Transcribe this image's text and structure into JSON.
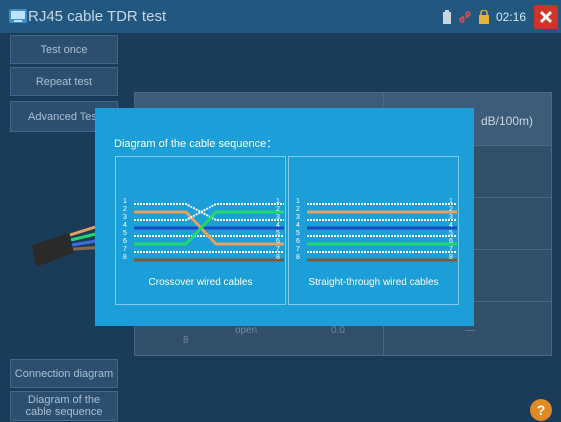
{
  "window": {
    "title": "RJ45 cable TDR test",
    "clock": "02:16"
  },
  "sidebar": {
    "test_once": "Test once",
    "repeat_test": "Repeat test",
    "advanced_test": "Advanced Test",
    "connection_diagram": "Connection diagram",
    "cable_sequence": "Diagram of the cable sequence"
  },
  "results_table": {
    "header_unit": "dB/100m)",
    "row_status": "open",
    "row_value": "0.0",
    "row_pair": "8",
    "row_dash": "—"
  },
  "dialog": {
    "title": "Diagram of the cable sequence：",
    "crossover": {
      "caption": "Crossover wired cables",
      "pins": [
        "1",
        "2",
        "3",
        "4",
        "5",
        "6",
        "7",
        "8"
      ]
    },
    "straight": {
      "caption": "Straight-through wired cables",
      "pins": [
        "1",
        "2",
        "3",
        "4",
        "5",
        "6",
        "7",
        "8"
      ]
    }
  },
  "colors": {
    "dialog_bg": "#1c9ed8",
    "titlebar_bg": "#22587f",
    "close_red": "#d0332c",
    "wire_orange": "#e7a15f",
    "wire_green": "#21d86a",
    "wire_blue": "#1c49c7",
    "wire_brown": "#7a5a3c"
  },
  "icons": [
    "app-icon",
    "battery-icon",
    "link-icon",
    "lock-icon",
    "close-icon",
    "help-icon"
  ]
}
